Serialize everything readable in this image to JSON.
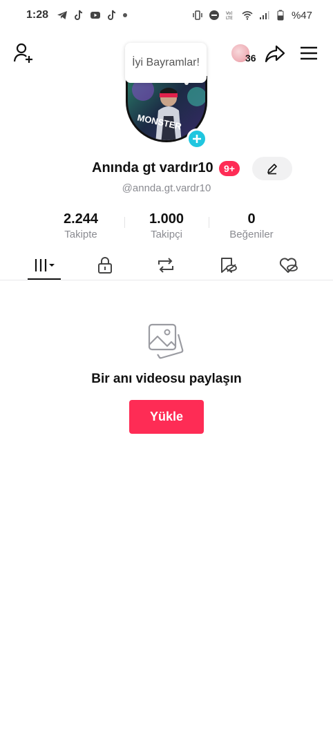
{
  "status_bar": {
    "time": "1:28",
    "battery": "%47",
    "left_icons": [
      "telegram-icon",
      "tiktok-icon",
      "youtube-icon",
      "tiktok-icon",
      "dot-icon"
    ],
    "right_icons": [
      "vibrate-icon",
      "dnd-icon",
      "volte-icon",
      "wifi-icon",
      "signal-icon",
      "battery-icon"
    ]
  },
  "header": {
    "visitor_count": "36",
    "tooltip": "İyi Bayramlar!"
  },
  "profile": {
    "display_name": "Anında gt vardır10",
    "notification_badge": "9+",
    "username": "@annda.gt.vardr10",
    "avatar_text": "MONSTER"
  },
  "stats": [
    {
      "value": "2.244",
      "label": "Takipte"
    },
    {
      "value": "1.000",
      "label": "Takipçi"
    },
    {
      "value": "0",
      "label": "Beğeniler"
    }
  ],
  "tabs": [
    "videos-grid-icon",
    "lock-icon",
    "repost-icon",
    "favorites-icon",
    "liked-icon"
  ],
  "empty_state": {
    "message": "Bir anı videosu paylaşın",
    "button": "Yükle"
  },
  "colors": {
    "accent": "#fe2c55",
    "add_badge": "#20c6df",
    "muted_text": "#8a8b91"
  }
}
